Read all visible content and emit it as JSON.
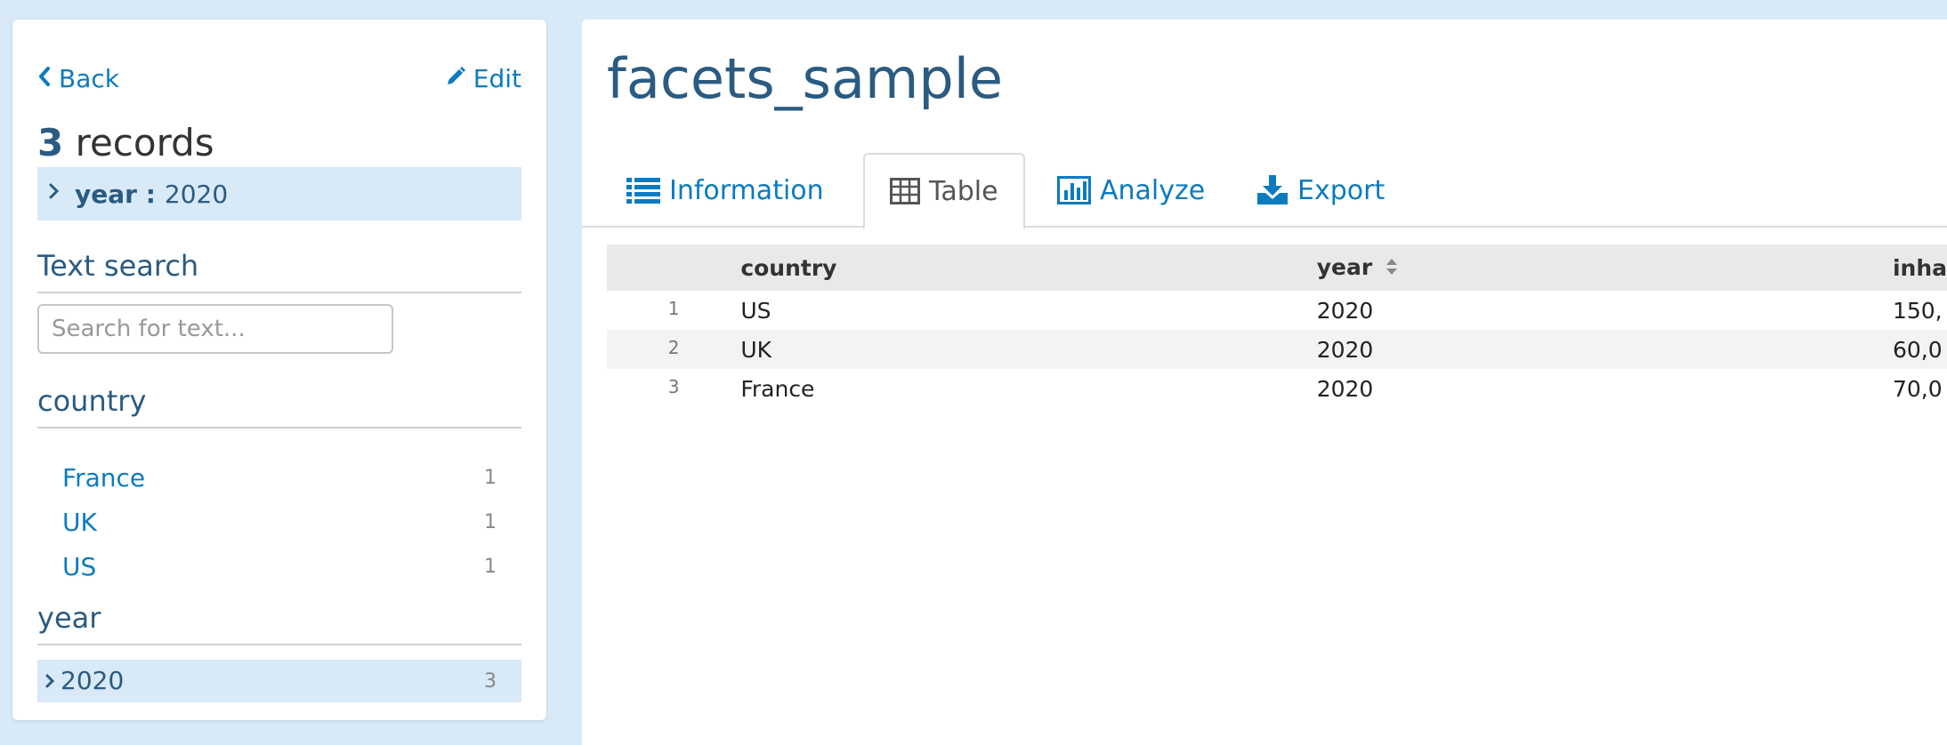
{
  "sidebar": {
    "back_label": "Back",
    "edit_label": "Edit",
    "record_count": "3",
    "records_label": "records",
    "active_filter": {
      "key": "year :",
      "value": "2020"
    },
    "text_search": {
      "title": "Text search",
      "placeholder": "Search for text..."
    },
    "country_facet": {
      "title": "country",
      "items": [
        {
          "label": "France",
          "count": "1"
        },
        {
          "label": "UK",
          "count": "1"
        },
        {
          "label": "US",
          "count": "1"
        }
      ]
    },
    "year_facet": {
      "title": "year",
      "items": [
        {
          "label": "2020",
          "count": "3"
        }
      ]
    }
  },
  "main": {
    "title": "facets_sample",
    "tabs": [
      {
        "label": "Information",
        "icon": "list-icon",
        "active": false
      },
      {
        "label": "Table",
        "icon": "table-icon",
        "active": true
      },
      {
        "label": "Analyze",
        "icon": "bar-chart-icon",
        "active": false
      },
      {
        "label": "Export",
        "icon": "download-icon",
        "active": false
      }
    ],
    "table": {
      "columns": [
        "country",
        "year",
        "inha"
      ],
      "rows": [
        {
          "index": "1",
          "country": "US",
          "year": "2020",
          "third": "150,"
        },
        {
          "index": "2",
          "country": "UK",
          "year": "2020",
          "third": "60,0"
        },
        {
          "index": "3",
          "country": "France",
          "year": "2020",
          "third": "70,0"
        }
      ]
    }
  },
  "colors": {
    "page_bg": "#d8e9f8",
    "link": "#0b7bbf",
    "heading": "#2a5b82",
    "highlight": "#d8e9f8"
  }
}
